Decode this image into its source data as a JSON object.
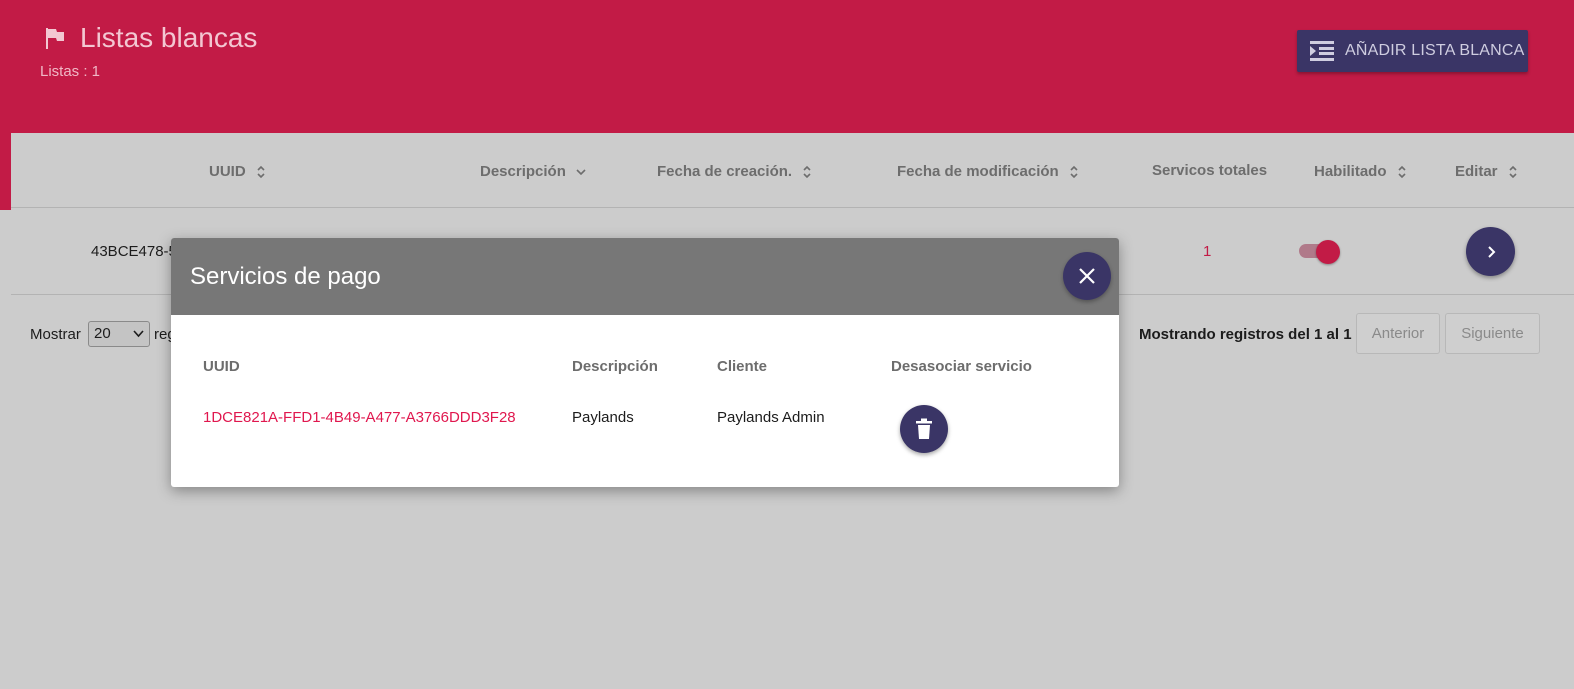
{
  "header": {
    "title": "Listas blancas",
    "subtitle": "Listas : 1",
    "add_button_label": "AÑADIR LISTA BLANCA"
  },
  "table": {
    "columns": [
      "UUID",
      "Descripción",
      "Fecha de creación.",
      "Fecha de modificación",
      "Servicos totales",
      "Habilitado",
      "Editar"
    ],
    "rows": [
      {
        "uuid": "43BCE478-5",
        "total_services": "1",
        "enabled": true
      }
    ]
  },
  "pagination": {
    "show_label": "Mostrar",
    "page_size": "20",
    "show_suffix": "reg",
    "records_info": "Mostrando registros del 1 al 1",
    "prev_label": "Anterior",
    "next_label": "Siguiente"
  },
  "modal": {
    "title": "Servicios de pago",
    "columns": [
      "UUID",
      "Descripción",
      "Cliente",
      "Desasociar servicio"
    ],
    "rows": [
      {
        "uuid": "1DCE821A-FFD1-4B49-A477-A3766DDD3F28",
        "description": "Paylands",
        "client": "Paylands Admin"
      }
    ]
  },
  "colors": {
    "brand": "#c21b46",
    "button": "#3a3566",
    "link": "#e0174e"
  },
  "icons": [
    "flag-icon",
    "list-add-icon",
    "sort-icon",
    "chevron-down-icon",
    "chevron-right-icon",
    "close-icon",
    "trash-icon"
  ]
}
